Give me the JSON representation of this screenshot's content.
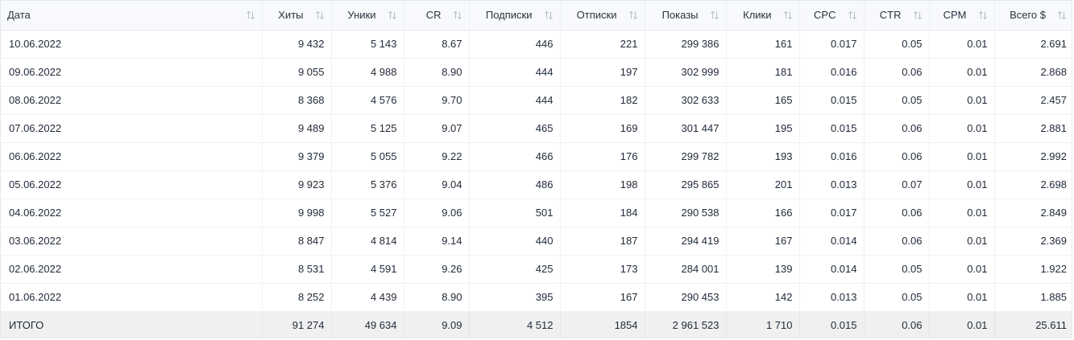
{
  "columns": [
    {
      "key": "date",
      "label": "Дата",
      "align": "left"
    },
    {
      "key": "hits",
      "label": "Хиты"
    },
    {
      "key": "uniques",
      "label": "Уники"
    },
    {
      "key": "cr",
      "label": "CR"
    },
    {
      "key": "subs",
      "label": "Подписки"
    },
    {
      "key": "unsubs",
      "label": "Отписки"
    },
    {
      "key": "impressions",
      "label": "Показы"
    },
    {
      "key": "clicks",
      "label": "Клики"
    },
    {
      "key": "cpc",
      "label": "CPC"
    },
    {
      "key": "ctr",
      "label": "CTR"
    },
    {
      "key": "cpm",
      "label": "CPM"
    },
    {
      "key": "total",
      "label": "Всего $"
    }
  ],
  "rows": [
    [
      "10.06.2022",
      "9 432",
      "5 143",
      "8.67",
      "446",
      "221",
      "299 386",
      "161",
      "0.017",
      "0.05",
      "0.01",
      "2.691"
    ],
    [
      "09.06.2022",
      "9 055",
      "4 988",
      "8.90",
      "444",
      "197",
      "302 999",
      "181",
      "0.016",
      "0.06",
      "0.01",
      "2.868"
    ],
    [
      "08.06.2022",
      "8 368",
      "4 576",
      "9.70",
      "444",
      "182",
      "302 633",
      "165",
      "0.015",
      "0.05",
      "0.01",
      "2.457"
    ],
    [
      "07.06.2022",
      "9 489",
      "5 125",
      "9.07",
      "465",
      "169",
      "301 447",
      "195",
      "0.015",
      "0.06",
      "0.01",
      "2.881"
    ],
    [
      "06.06.2022",
      "9 379",
      "5 055",
      "9.22",
      "466",
      "176",
      "299 782",
      "193",
      "0.016",
      "0.06",
      "0.01",
      "2.992"
    ],
    [
      "05.06.2022",
      "9 923",
      "5 376",
      "9.04",
      "486",
      "198",
      "295 865",
      "201",
      "0.013",
      "0.07",
      "0.01",
      "2.698"
    ],
    [
      "04.06.2022",
      "9 998",
      "5 527",
      "9.06",
      "501",
      "184",
      "290 538",
      "166",
      "0.017",
      "0.06",
      "0.01",
      "2.849"
    ],
    [
      "03.06.2022",
      "8 847",
      "4 814",
      "9.14",
      "440",
      "187",
      "294 419",
      "167",
      "0.014",
      "0.06",
      "0.01",
      "2.369"
    ],
    [
      "02.06.2022",
      "8 531",
      "4 591",
      "9.26",
      "425",
      "173",
      "284 001",
      "139",
      "0.014",
      "0.05",
      "0.01",
      "1.922"
    ],
    [
      "01.06.2022",
      "8 252",
      "4 439",
      "8.90",
      "395",
      "167",
      "290 453",
      "142",
      "0.013",
      "0.05",
      "0.01",
      "1.885"
    ]
  ],
  "totals": [
    "ИТОГО",
    "91 274",
    "49 634",
    "9.09",
    "4 512",
    "1854",
    "2 961 523",
    "1 710",
    "0.015",
    "0.06",
    "0.01",
    "25.611"
  ],
  "icons": {
    "sort": "sort-arrows-icon"
  },
  "colors": {
    "header_bg": "#f7f9fc",
    "total_bg": "#f0f0f0",
    "sort_icon": "#b8c0cc"
  }
}
